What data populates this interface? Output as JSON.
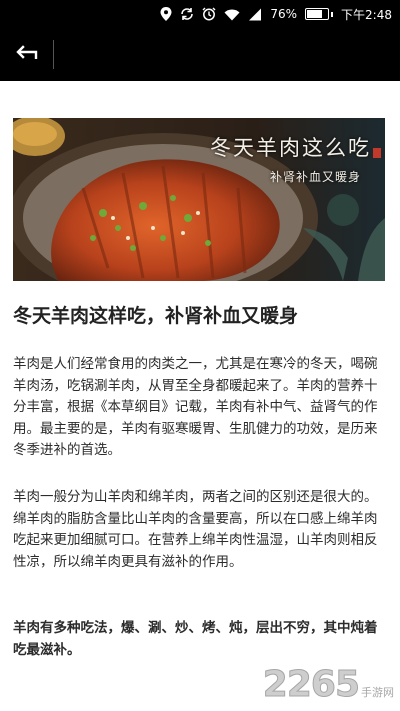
{
  "status_bar": {
    "battery": "76%",
    "time": "下午2:48",
    "battery_level": 0.76,
    "icons": [
      "location-icon",
      "sync-icon",
      "alarm-icon",
      "wifi-icon",
      "signal-icon",
      "battery-icon"
    ]
  },
  "toolbar": {
    "back_icon": "back-arrow-icon"
  },
  "banner": {
    "title": "冬天羊肉这么吃",
    "subtitle": "补肾补血又暖身"
  },
  "article": {
    "title": "冬天羊肉这样吃，补肾补血又暖身",
    "paragraphs": [
      "羊肉是人们经常食用的肉类之一，尤其是在寒冷的冬天，喝碗羊肉汤，吃锅涮羊肉，从胃至全身都暖起来了。羊肉的营养十分丰富，根据《本草纲目》记载，羊肉有补中气、益肾气的作用。最主要的是，羊肉有驱寒暖胃、生肌健力的功效，是历来冬季进补的首选。",
      "羊肉一般分为山羊肉和绵羊肉，两者之间的区别还是很大的。绵羊肉的脂肪含量比山羊肉的含量要高，所以在口感上绵羊肉吃起来更加细腻可口。在营养上绵羊肉性温湿，山羊肉则相反性凉，所以绵羊肉更具有滋补的作用。",
      "羊肉有多种吃法，爆、涮、炒、烤、炖，层出不穷，其中炖着吃最滋补。"
    ]
  },
  "watermark": {
    "number": "2265",
    "site": "手游网"
  }
}
